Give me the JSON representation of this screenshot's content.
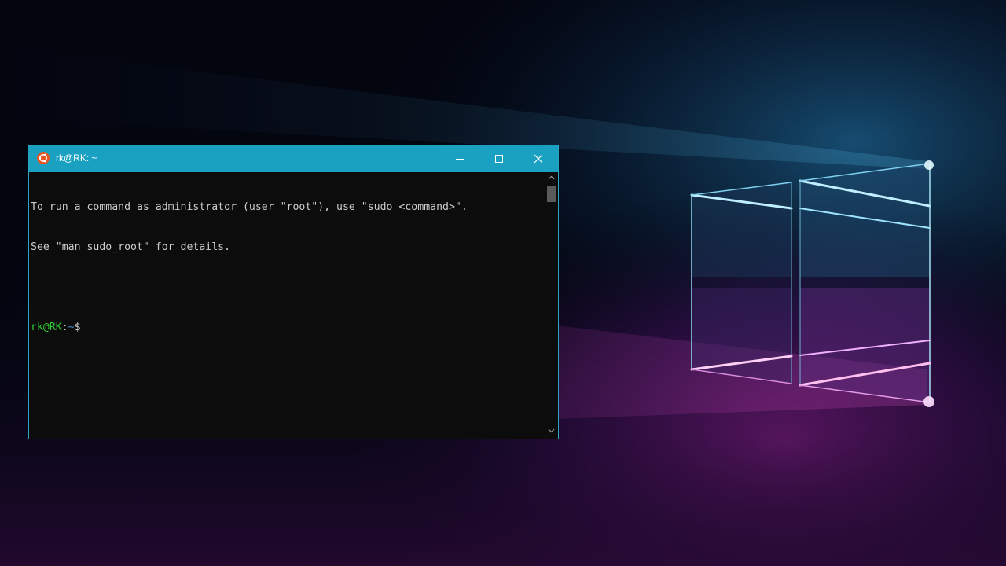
{
  "window": {
    "title": "rk@RK: ~",
    "icon": "ubuntu-icon",
    "accent_color": "#1aa1c2",
    "controls": [
      "minimize-icon",
      "maximize-icon",
      "close-icon"
    ]
  },
  "terminal": {
    "lines": [
      "To run a command as administrator (user \"root\"), use \"sudo <command>\".",
      "See \"man sudo_root\" for details.",
      ""
    ],
    "prompt": {
      "user_host": "rk@RK",
      "separator": ":",
      "path": "~",
      "symbol": "$"
    },
    "colors": {
      "background": "#0c0c0c",
      "text": "#cccccc",
      "user": "#2fcc2f",
      "path": "#4b8cd6"
    }
  }
}
